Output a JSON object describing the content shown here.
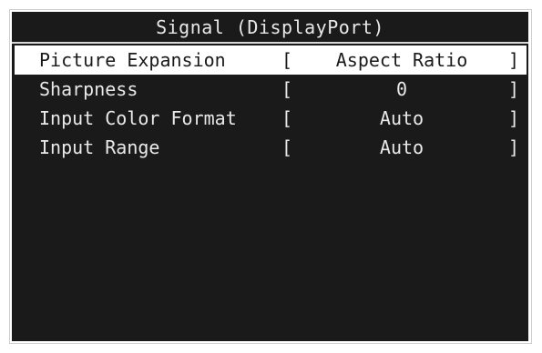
{
  "window": {
    "title": "Signal (DisplayPort)"
  },
  "menu": {
    "bracket_open": "[",
    "bracket_close": "]",
    "items": [
      {
        "label": "Picture Expansion",
        "value": "Aspect Ratio",
        "selected": true
      },
      {
        "label": "Sharpness",
        "value": "0",
        "selected": false
      },
      {
        "label": "Input Color Format",
        "value": "Auto",
        "selected": false
      },
      {
        "label": "Input Range",
        "value": "Auto",
        "selected": false
      }
    ]
  },
  "colors": {
    "panel_background": "#1a1a1a",
    "text": "#e9e9e9",
    "selection_background": "#ffffff",
    "selection_text": "#1a1a1a"
  }
}
